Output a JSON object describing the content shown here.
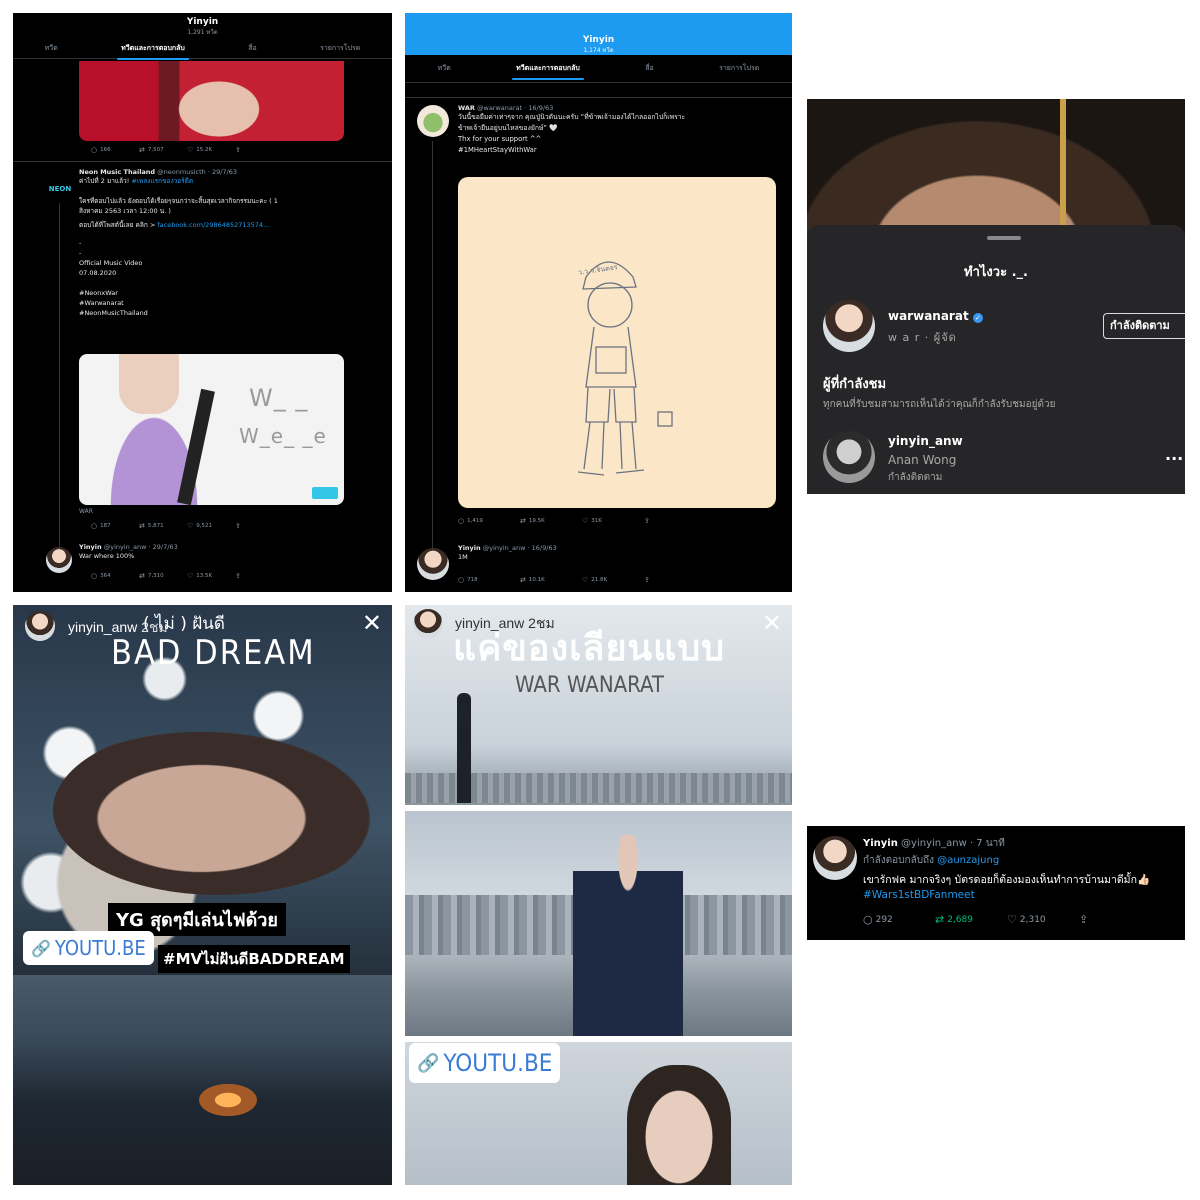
{
  "panel1": {
    "header": {
      "name": "Yinyin",
      "count": "1,291 ทวีต"
    },
    "tabs": [
      "ทวีต",
      "ทวีตและการตอบกลับ",
      "สื่อ",
      "รายการโปรด"
    ],
    "top_actions": {
      "reply": "166",
      "retweet": "7,507",
      "like": "15.2K"
    },
    "tweet": {
      "author": "Neon Music Thailand",
      "handle": "@neonmusicth · 29/7/63",
      "line1": "ค่าไปที่ 2 มาแล้ว! ",
      "line1_tag": "#เพลงแรกของวอร์ดีต",
      "line2": "ใครที่ตอบไปแล้ว ยังตอบได้เรื่อยๆจนกว่าจะสิ้นสุดเวลากิจกรรมนะคะ ( 1",
      "line3": "สิงหาคม 2563 เวลา 12:00 น. )",
      "line4": "ตอบได้ที่โพสต์นี้เลย คลิก > ",
      "line4_link": "facebook.com/29864852713574...",
      "dot1": "-",
      "dot2": "-",
      "mv1": "Official Music Video",
      "mv2": "07.08.2020",
      "tag1": "#NeonxWar",
      "tag2": "#Warwanarat",
      "tag3": "#NeonMusicThailand",
      "image_text1": "W_ _",
      "image_text2": "W_e_ _e",
      "caption": "WAR",
      "actions": {
        "reply": "187",
        "retweet": "5,871",
        "like": "9,521"
      }
    },
    "reply": {
      "author": "Yinyin",
      "handle": "@yinyin_anw · 29/7/63",
      "text": "War where 100%",
      "actions": {
        "reply": "364",
        "retweet": "7,310",
        "like": "13.5K"
      }
    }
  },
  "panel2": {
    "header": {
      "name": "Yinyin",
      "count": "1,174 ทวีต"
    },
    "tabs": [
      "ทวีต",
      "ทวีตและการตอบกลับ",
      "สื่อ",
      "รายการโปรด"
    ],
    "tweet": {
      "author": "WAR",
      "handle": "@warwanarat · 16/9/63",
      "line1": "วันนี้ขอยืมค่าเท่าๆจาก คุณปู่นิวตันนะครับ “ที่ข้าพเจ้ามองได้ไกลออกไปก็เพราะ",
      "line2": "ข้าพเจ้ายืนอยู่บนไหล่ของยักษ์” 🤍",
      "line3": "Thx for your support ^^",
      "tag": "#1MHeartStayWithWar",
      "drawing_text": "ว.ว.ว.จินตจร",
      "actions": {
        "reply": "1,419",
        "retweet": "19.5K",
        "like": "31K"
      }
    },
    "reply": {
      "author": "Yinyin",
      "handle": "@yinyin_anw · 16/9/63",
      "text": "1M",
      "actions": {
        "reply": "718",
        "retweet": "10.1K",
        "like": "21.8K"
      }
    }
  },
  "panel3": {
    "title": "ทำไงวะ ._.",
    "host": {
      "name": "warwanarat",
      "sub": "w a r · ผู้จัด",
      "follow": "กำลังติดตาม"
    },
    "viewers_title": "ผู้ที่กำลังชม",
    "viewers_desc": "ทุกคนที่รับชมสามารถเห็นได้ว่าคุณก็กำลังรับชมอยู่ด้วย",
    "viewer": {
      "name": "yinyin_anw",
      "sub": "Anan Wong",
      "status": "กำลังติดตาม",
      "more": "..."
    }
  },
  "panel4": {
    "user": "yinyin_anw",
    "time": "2ชม",
    "thai_small": "( ไม่ ) ฝันดี",
    "title": "BAD DREAM",
    "caption": "YG สุดๆมีเล่นไฟด้วย",
    "link": "YOUTU.BE",
    "hashtag": "#MVไม่ฝันดีBADDREAM"
  },
  "panel5": {
    "user": "yinyin_anw",
    "time": "2ชม",
    "title": "แค่ของเลียนแบบ",
    "subtitle": "WAR WANARAT",
    "link": "YOUTU.BE"
  },
  "panel6": {
    "author": "Yinyin",
    "handle": "@yinyin_anw · 7 นาที",
    "replying": "กำลังตอบกลับถึง ",
    "replying_to": "@aunzajung",
    "text": "เขารักฟค มากจริงๆ บัตรดอยก็ต้องมองเห็นทำการบ้านมาดีมั้ก👍🏻",
    "tag": "#Wars1stBDFanmeet",
    "actions": {
      "reply": "292",
      "retweet": "2,689",
      "like": "2,310"
    }
  },
  "colors": {
    "twitter_blue": "#1d9bf0",
    "retweet_green": "#00ba7c",
    "link_blue": "#3a7bd5"
  }
}
